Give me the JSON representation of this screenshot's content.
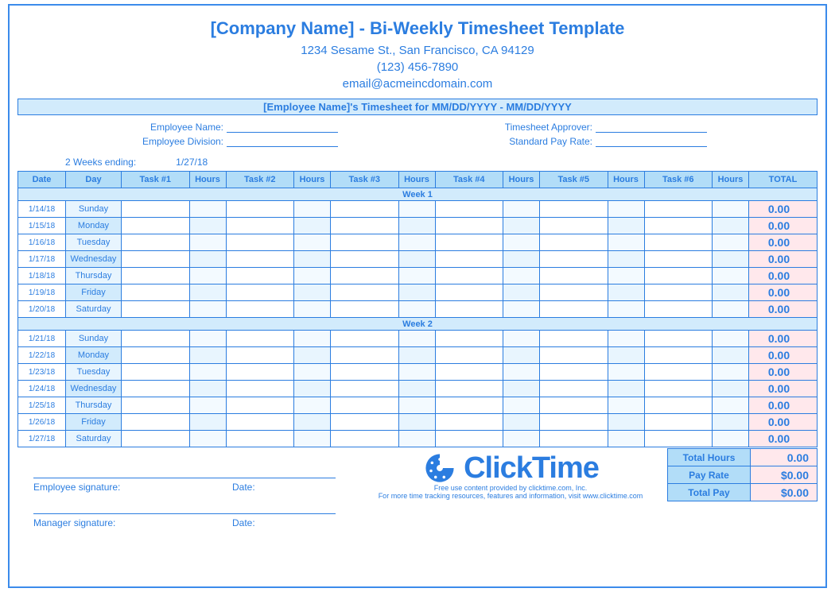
{
  "title": "[Company Name] - Bi-Weekly Timesheet Template",
  "contact": {
    "address": "1234 Sesame St.,  San Francisco, CA 94129",
    "phone": "(123) 456-7890",
    "email": "email@acmeincdomain.com"
  },
  "banner": "[Employee Name]'s Timesheet for MM/DD/YYYY - MM/DD/YYYY",
  "info": {
    "emp_name_label": "Employee Name:",
    "emp_div_label": "Employee Division:",
    "approver_label": "Timesheet Approver:",
    "payrate_label": "Standard Pay Rate:"
  },
  "weeks_ending_label": "2 Weeks ending:",
  "weeks_ending_value": "1/27/18",
  "columns": [
    "Date",
    "Day",
    "Task #1",
    "Hours",
    "Task #2",
    "Hours",
    "Task #3",
    "Hours",
    "Task #4",
    "Hours",
    "Task #5",
    "Hours",
    "Task #6",
    "Hours",
    "TOTAL"
  ],
  "week1_label": "Week 1",
  "week2_label": "Week 2",
  "week1": [
    {
      "date": "1/14/18",
      "day": "Sunday",
      "total": "0.00"
    },
    {
      "date": "1/15/18",
      "day": "Monday",
      "total": "0.00"
    },
    {
      "date": "1/16/18",
      "day": "Tuesday",
      "total": "0.00"
    },
    {
      "date": "1/17/18",
      "day": "Wednesday",
      "total": "0.00"
    },
    {
      "date": "1/18/18",
      "day": "Thursday",
      "total": "0.00"
    },
    {
      "date": "1/19/18",
      "day": "Friday",
      "total": "0.00"
    },
    {
      "date": "1/20/18",
      "day": "Saturday",
      "total": "0.00"
    }
  ],
  "week2": [
    {
      "date": "1/21/18",
      "day": "Sunday",
      "total": "0.00"
    },
    {
      "date": "1/22/18",
      "day": "Monday",
      "total": "0.00"
    },
    {
      "date": "1/23/18",
      "day": "Tuesday",
      "total": "0.00"
    },
    {
      "date": "1/24/18",
      "day": "Wednesday",
      "total": "0.00"
    },
    {
      "date": "1/25/18",
      "day": "Thursday",
      "total": "0.00"
    },
    {
      "date": "1/26/18",
      "day": "Friday",
      "total": "0.00"
    },
    {
      "date": "1/27/18",
      "day": "Saturday",
      "total": "0.00"
    }
  ],
  "sig": {
    "employee": "Employee signature:",
    "manager": "Manager signature:",
    "date": "Date:"
  },
  "logo_text": "ClickTime",
  "logo_sub1": "Free use content provided by clicktime.com, Inc.",
  "logo_sub2": "For more time tracking resources, features and information, visit www.clicktime.com",
  "summary": {
    "total_hours_label": "Total Hours",
    "total_hours_value": "0.00",
    "pay_rate_label": "Pay Rate",
    "pay_rate_value": "$0.00",
    "total_pay_label": "Total Pay",
    "total_pay_value": "$0.00"
  }
}
